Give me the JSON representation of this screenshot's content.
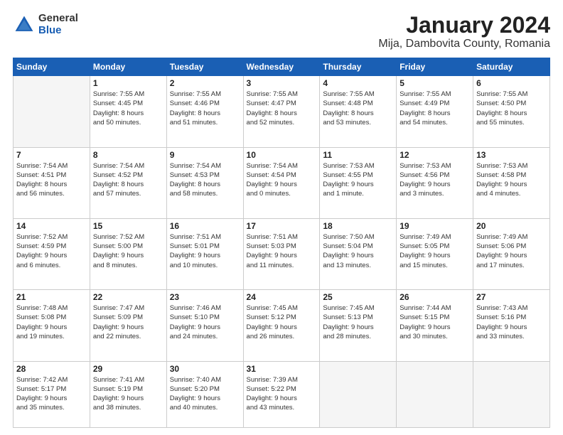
{
  "logo": {
    "general": "General",
    "blue": "Blue"
  },
  "title": {
    "month": "January 2024",
    "location": "Mija, Dambovita County, Romania"
  },
  "weekdays": [
    "Sunday",
    "Monday",
    "Tuesday",
    "Wednesday",
    "Thursday",
    "Friday",
    "Saturday"
  ],
  "weeks": [
    [
      {
        "day": "",
        "info": ""
      },
      {
        "day": "1",
        "info": "Sunrise: 7:55 AM\nSunset: 4:45 PM\nDaylight: 8 hours\nand 50 minutes."
      },
      {
        "day": "2",
        "info": "Sunrise: 7:55 AM\nSunset: 4:46 PM\nDaylight: 8 hours\nand 51 minutes."
      },
      {
        "day": "3",
        "info": "Sunrise: 7:55 AM\nSunset: 4:47 PM\nDaylight: 8 hours\nand 52 minutes."
      },
      {
        "day": "4",
        "info": "Sunrise: 7:55 AM\nSunset: 4:48 PM\nDaylight: 8 hours\nand 53 minutes."
      },
      {
        "day": "5",
        "info": "Sunrise: 7:55 AM\nSunset: 4:49 PM\nDaylight: 8 hours\nand 54 minutes."
      },
      {
        "day": "6",
        "info": "Sunrise: 7:55 AM\nSunset: 4:50 PM\nDaylight: 8 hours\nand 55 minutes."
      }
    ],
    [
      {
        "day": "7",
        "info": "Sunrise: 7:54 AM\nSunset: 4:51 PM\nDaylight: 8 hours\nand 56 minutes."
      },
      {
        "day": "8",
        "info": "Sunrise: 7:54 AM\nSunset: 4:52 PM\nDaylight: 8 hours\nand 57 minutes."
      },
      {
        "day": "9",
        "info": "Sunrise: 7:54 AM\nSunset: 4:53 PM\nDaylight: 8 hours\nand 58 minutes."
      },
      {
        "day": "10",
        "info": "Sunrise: 7:54 AM\nSunset: 4:54 PM\nDaylight: 9 hours\nand 0 minutes."
      },
      {
        "day": "11",
        "info": "Sunrise: 7:53 AM\nSunset: 4:55 PM\nDaylight: 9 hours\nand 1 minute."
      },
      {
        "day": "12",
        "info": "Sunrise: 7:53 AM\nSunset: 4:56 PM\nDaylight: 9 hours\nand 3 minutes."
      },
      {
        "day": "13",
        "info": "Sunrise: 7:53 AM\nSunset: 4:58 PM\nDaylight: 9 hours\nand 4 minutes."
      }
    ],
    [
      {
        "day": "14",
        "info": "Sunrise: 7:52 AM\nSunset: 4:59 PM\nDaylight: 9 hours\nand 6 minutes."
      },
      {
        "day": "15",
        "info": "Sunrise: 7:52 AM\nSunset: 5:00 PM\nDaylight: 9 hours\nand 8 minutes."
      },
      {
        "day": "16",
        "info": "Sunrise: 7:51 AM\nSunset: 5:01 PM\nDaylight: 9 hours\nand 10 minutes."
      },
      {
        "day": "17",
        "info": "Sunrise: 7:51 AM\nSunset: 5:03 PM\nDaylight: 9 hours\nand 11 minutes."
      },
      {
        "day": "18",
        "info": "Sunrise: 7:50 AM\nSunset: 5:04 PM\nDaylight: 9 hours\nand 13 minutes."
      },
      {
        "day": "19",
        "info": "Sunrise: 7:49 AM\nSunset: 5:05 PM\nDaylight: 9 hours\nand 15 minutes."
      },
      {
        "day": "20",
        "info": "Sunrise: 7:49 AM\nSunset: 5:06 PM\nDaylight: 9 hours\nand 17 minutes."
      }
    ],
    [
      {
        "day": "21",
        "info": "Sunrise: 7:48 AM\nSunset: 5:08 PM\nDaylight: 9 hours\nand 19 minutes."
      },
      {
        "day": "22",
        "info": "Sunrise: 7:47 AM\nSunset: 5:09 PM\nDaylight: 9 hours\nand 22 minutes."
      },
      {
        "day": "23",
        "info": "Sunrise: 7:46 AM\nSunset: 5:10 PM\nDaylight: 9 hours\nand 24 minutes."
      },
      {
        "day": "24",
        "info": "Sunrise: 7:45 AM\nSunset: 5:12 PM\nDaylight: 9 hours\nand 26 minutes."
      },
      {
        "day": "25",
        "info": "Sunrise: 7:45 AM\nSunset: 5:13 PM\nDaylight: 9 hours\nand 28 minutes."
      },
      {
        "day": "26",
        "info": "Sunrise: 7:44 AM\nSunset: 5:15 PM\nDaylight: 9 hours\nand 30 minutes."
      },
      {
        "day": "27",
        "info": "Sunrise: 7:43 AM\nSunset: 5:16 PM\nDaylight: 9 hours\nand 33 minutes."
      }
    ],
    [
      {
        "day": "28",
        "info": "Sunrise: 7:42 AM\nSunset: 5:17 PM\nDaylight: 9 hours\nand 35 minutes."
      },
      {
        "day": "29",
        "info": "Sunrise: 7:41 AM\nSunset: 5:19 PM\nDaylight: 9 hours\nand 38 minutes."
      },
      {
        "day": "30",
        "info": "Sunrise: 7:40 AM\nSunset: 5:20 PM\nDaylight: 9 hours\nand 40 minutes."
      },
      {
        "day": "31",
        "info": "Sunrise: 7:39 AM\nSunset: 5:22 PM\nDaylight: 9 hours\nand 43 minutes."
      },
      {
        "day": "",
        "info": ""
      },
      {
        "day": "",
        "info": ""
      },
      {
        "day": "",
        "info": ""
      }
    ]
  ]
}
